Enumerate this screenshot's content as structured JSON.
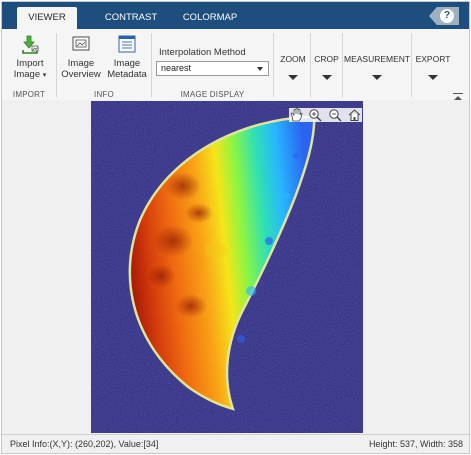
{
  "tabs": [
    {
      "label": "VIEWER",
      "active": true
    },
    {
      "label": "CONTRAST",
      "active": false
    },
    {
      "label": "COLORMAP",
      "active": false
    }
  ],
  "help": {
    "label": "?"
  },
  "toolstrip": {
    "import": {
      "section_label": "IMPORT",
      "import_image": {
        "line1": "Import",
        "line2": "Image",
        "caret": "▾"
      }
    },
    "info": {
      "section_label": "INFO",
      "image_overview": {
        "line1": "Image",
        "line2": "Overview"
      },
      "image_metadata": {
        "line1": "Image",
        "line2": "Metadata"
      }
    },
    "image_display": {
      "section_label": "IMAGE DISPLAY",
      "interpolation_label": "Interpolation Method",
      "interpolation_value": "nearest"
    },
    "zoom": {
      "label": "ZOOM"
    },
    "crop": {
      "label": "CROP"
    },
    "measurement": {
      "label": "MEASUREMENT"
    },
    "export": {
      "label": "EXPORT"
    }
  },
  "status": {
    "pixel_info": "Pixel Info:(X,Y): (260,202), Value:[34]",
    "image_size": "Height: 537, Width: 358"
  },
  "colors": {
    "tab_bar": "#1e4e7e",
    "colormap_background": "#2b2a7a",
    "colormap_high": "#c0200a",
    "colormap_low": "#1e90ff"
  }
}
